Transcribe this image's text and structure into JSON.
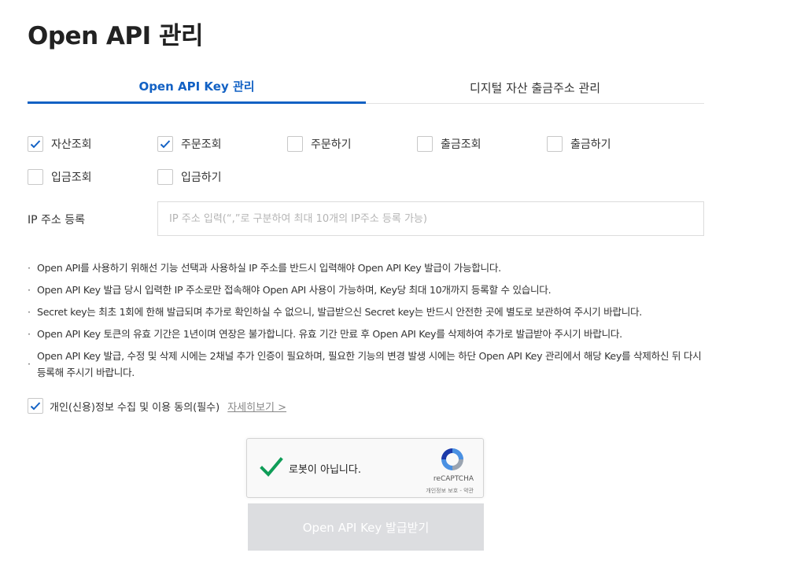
{
  "page": {
    "title": "Open API 관리"
  },
  "tabs": [
    {
      "label": "Open API Key 관리",
      "active": true
    },
    {
      "label": "디지털 자산 출금주소 관리",
      "active": false
    }
  ],
  "permissions": [
    {
      "label": "자산조회",
      "checked": true
    },
    {
      "label": "주문조회",
      "checked": true
    },
    {
      "label": "주문하기",
      "checked": false
    },
    {
      "label": "출금조회",
      "checked": false
    },
    {
      "label": "출금하기",
      "checked": false
    },
    {
      "label": "입금조회",
      "checked": false
    },
    {
      "label": "입금하기",
      "checked": false
    }
  ],
  "ip": {
    "label": "IP 주소 등록",
    "placeholder": "IP 주소 입력(“,”로 구분하여 최대 10개의 IP주소 등록 가능)",
    "value": ""
  },
  "notes": [
    "Open API를 사용하기 위해선 기능 선택과 사용하실 IP 주소를 반드시 입력해야 Open API Key 발급이 가능합니다.",
    "Open API Key 발급 당시 입력한 IP 주소로만 접속해야 Open API 사용이 가능하며, Key당 최대 10개까지 등록할 수 있습니다.",
    "Secret key는 최초 1회에 한해 발급되며 추가로 확인하실 수 없으니, 발급받으신 Secret key는 반드시 안전한 곳에 별도로 보관하여 주시기 바랍니다.",
    "Open API Key 토큰의 유효 기간은 1년이며 연장은 불가합니다. 유효 기간 만료 후 Open API Key를 삭제하여 추가로 발급받아 주시기 바랍니다.",
    "Open API Key 발급, 수정 및 삭제 시에는 2채널 추가 인증이 필요하며, 필요한 기능의 변경 발생 시에는 하단 Open API Key 관리에서 해당 Key를 삭제하신 뒤 다시 등록해 주시기 바랍니다."
  ],
  "agreement": {
    "label": "개인(신용)정보 수집 및 이용 동의(필수)",
    "checked": true,
    "link": "자세히보기 >"
  },
  "captcha": {
    "label": "로봇이 아닙니다.",
    "brand": "reCAPTCHA",
    "terms": "개인정보 보호 - 약관",
    "checked": true,
    "check_color": "#0f9d58"
  },
  "submit": {
    "label": "Open API Key 발급받기",
    "enabled": false
  },
  "colors": {
    "accent": "#1261c4",
    "disabled_button": "#dcdde0"
  }
}
